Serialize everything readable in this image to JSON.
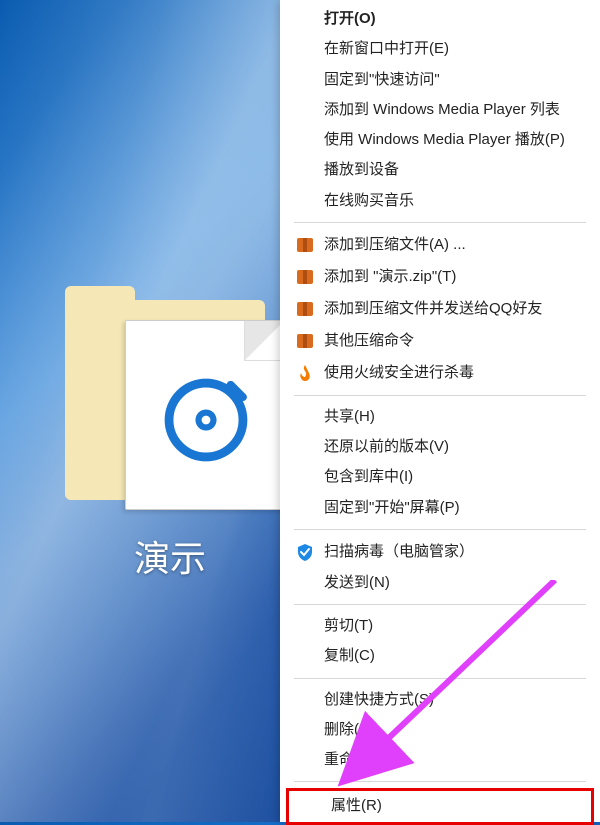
{
  "folder": {
    "label": "演示"
  },
  "menu": {
    "open": "打开(O)",
    "open_new": "在新窗口中打开(E)",
    "pin_quick": "固定到\"快速访问\"",
    "wmp_list": "添加到 Windows Media Player 列表",
    "wmp_play": "使用 Windows Media Player 播放(P)",
    "cast": "播放到设备",
    "buy_music": "在线购买音乐",
    "archive_add": "添加到压缩文件(A) ...",
    "archive_zip": "添加到 \"演示.zip\"(T)",
    "archive_qq": "添加到压缩文件并发送给QQ好友",
    "archive_other": "其他压缩命令",
    "huorong": "使用火绒安全进行杀毒",
    "share": "共享(H)",
    "restore": "还原以前的版本(V)",
    "include_lib": "包含到库中(I)",
    "pin_start": "固定到\"开始\"屏幕(P)",
    "scan_qq": "扫描病毒（电脑管家）",
    "send_to": "发送到(N)",
    "cut": "剪切(T)",
    "copy": "复制(C)",
    "shortcut": "创建快捷方式(S)",
    "delete": "删除(D)",
    "rename": "重命名(M)",
    "properties": "属性(R)"
  }
}
